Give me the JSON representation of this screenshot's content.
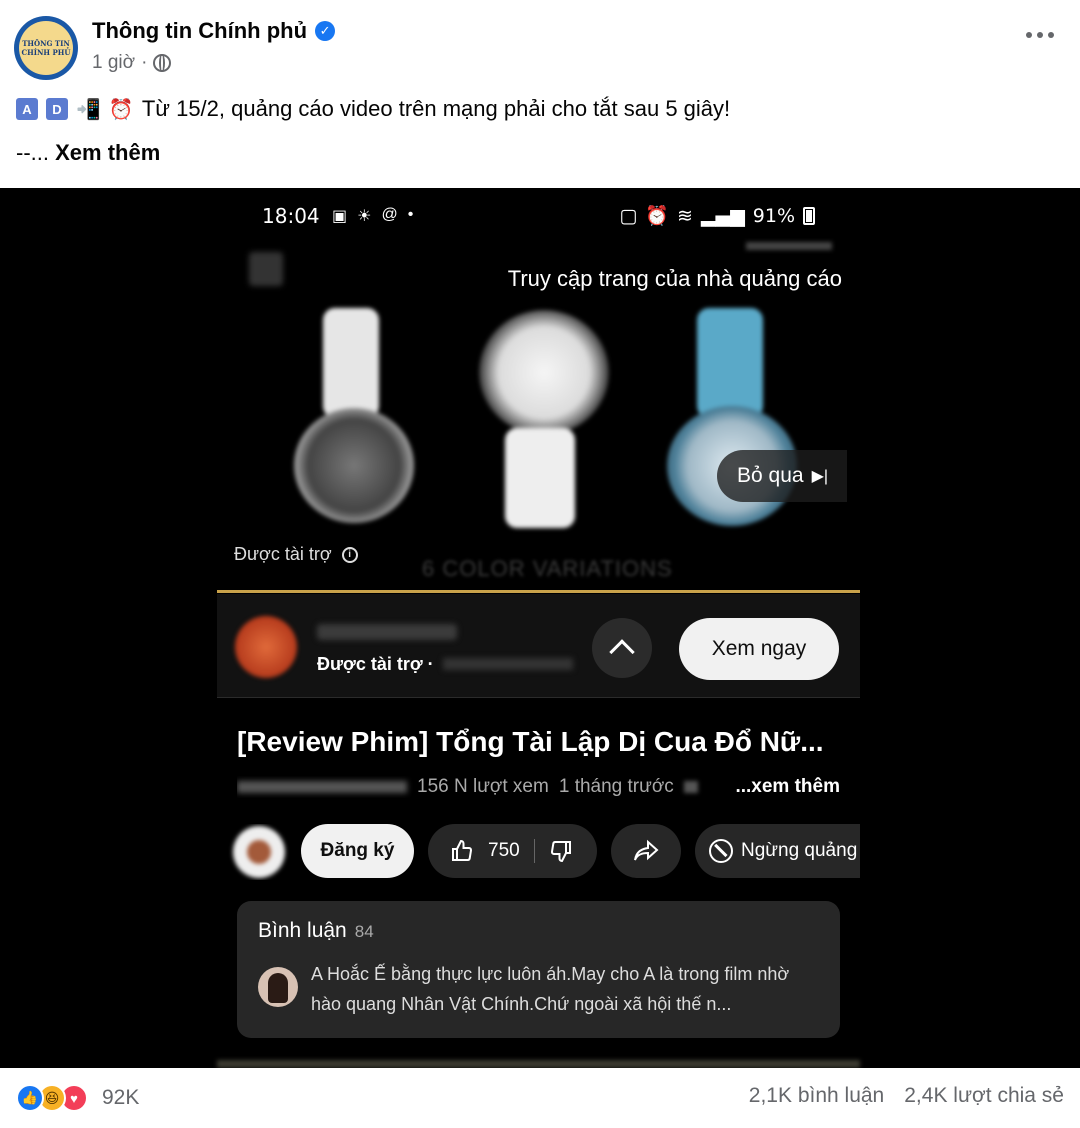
{
  "post": {
    "page_name": "Thông tin Chính phủ",
    "time_ago": "1 giờ",
    "separator": "·",
    "avatar_text_1": "THÔNG TIN",
    "avatar_text_2": "CHÍNH PHỦ",
    "caption_emoji_a": "A",
    "caption_emoji_d": "D",
    "caption_text": "Từ 15/2, quảng cáo video trên mạng phải cho tắt sau 5 giây!",
    "caption_ellipsis": "--...",
    "see_more": "Xem thêm"
  },
  "phone": {
    "status_time": "18:04",
    "battery": "91%",
    "ad_visit_label": "Truy cập trang của nhà quảng cáo",
    "skip_label": "Bỏ qua",
    "skip_icon": "▶|",
    "sponsored_label": "Được tài trợ",
    "variations_text": "6 COLOR VARIATIONS",
    "ad_bar": {
      "sponsored": "Được tài trợ ·",
      "watch_now": "Xem ngay"
    },
    "video_title": "[Review Phim] Tổng Tài Lập Dị Cua Đổ Nữ...",
    "video_views": "156 N lượt xem",
    "video_age": "1 tháng trước",
    "video_meta_more": "...xem thêm",
    "subscribe": "Đăng ký",
    "likes": "750",
    "stop_ads": "Ngừng quảng",
    "comments_label": "Bình luận",
    "comments_count": "84",
    "comment_text": "A Hoắc Ế bằng thực lực luôn áh.May cho A là trong film nhờ hào quang Nhân Vật Chính.Chứ ngoài xã hội thế n..."
  },
  "footer": {
    "reaction_count": "92K",
    "comments": "2,1K bình luận",
    "shares": "2,4K lượt chia sẻ"
  },
  "icons": [
    "verified-badge-icon",
    "globe-icon",
    "more-icon",
    "skip-icon",
    "info-icon",
    "chevron-up-icon",
    "like-icon",
    "dislike-icon",
    "share-icon",
    "ban-icon",
    "like-reaction-icon",
    "haha-reaction-icon",
    "love-reaction-icon"
  ],
  "colors": {
    "facebook_blue": "#1877f2",
    "progress_gold": "#c9a24a"
  }
}
